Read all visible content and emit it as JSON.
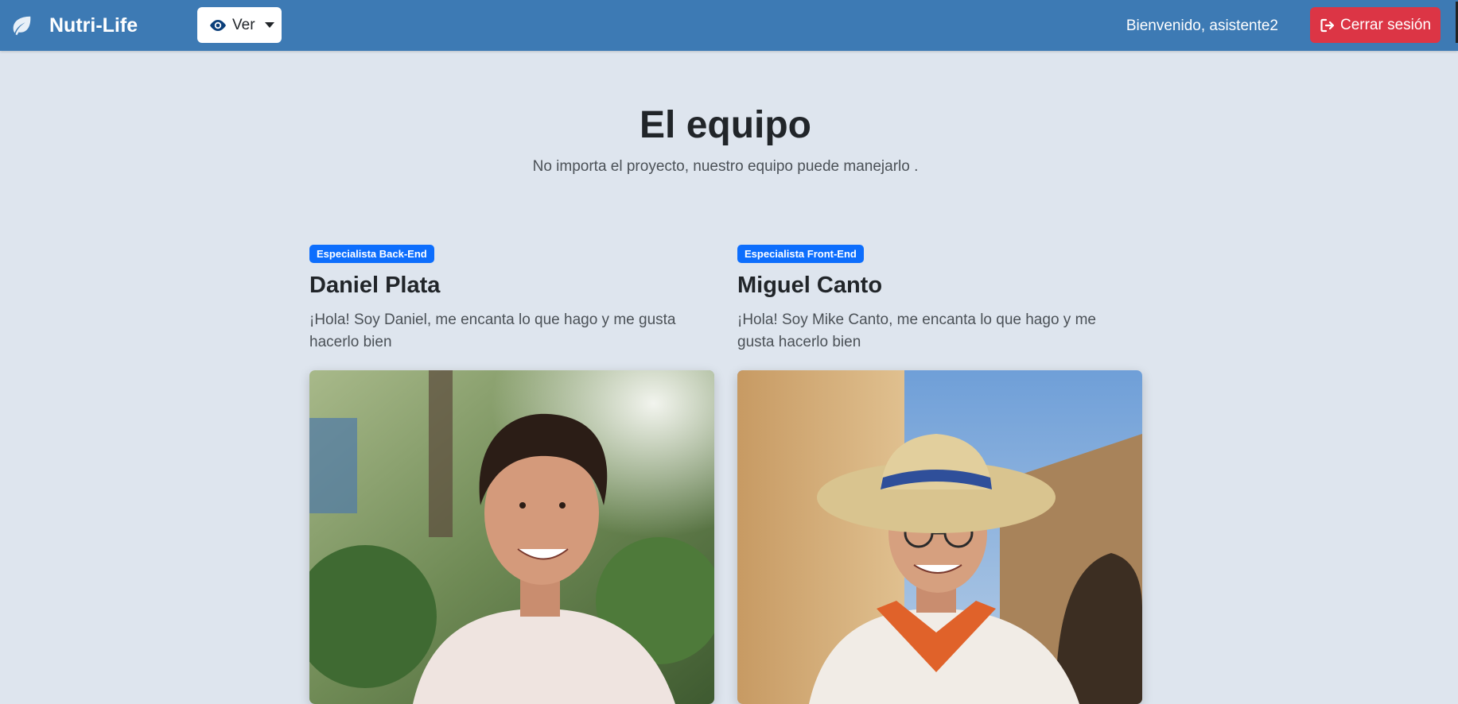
{
  "navbar": {
    "brand": "Nutri-Life",
    "brand_icon": "leaf-icon",
    "ver_label": "Ver",
    "ver_icon": "eye-icon",
    "welcome": "Bienvenido, asistente2",
    "logout_label": "Cerrar sesión",
    "logout_icon": "sign-out-icon",
    "bg_color": "#3d7ab4",
    "logout_color": "#dc3545"
  },
  "hero": {
    "title": "El equipo",
    "subtitle": "No importa el proyecto, nuestro equipo puede manejarlo ."
  },
  "team": [
    {
      "role": "Especialista Back-End",
      "name": "Daniel Plata",
      "bio": "¡Hola! Soy Daniel, me encanta lo que hago y me gusta hacerlo bien"
    },
    {
      "role": "Especialista Front-End",
      "name": "Miguel Canto",
      "bio": "¡Hola! Soy Mike Canto, me encanta lo que hago y me gusta hacerlo bien"
    }
  ],
  "colors": {
    "page_bg": "#dee5ee",
    "badge": "#0d6efd"
  }
}
